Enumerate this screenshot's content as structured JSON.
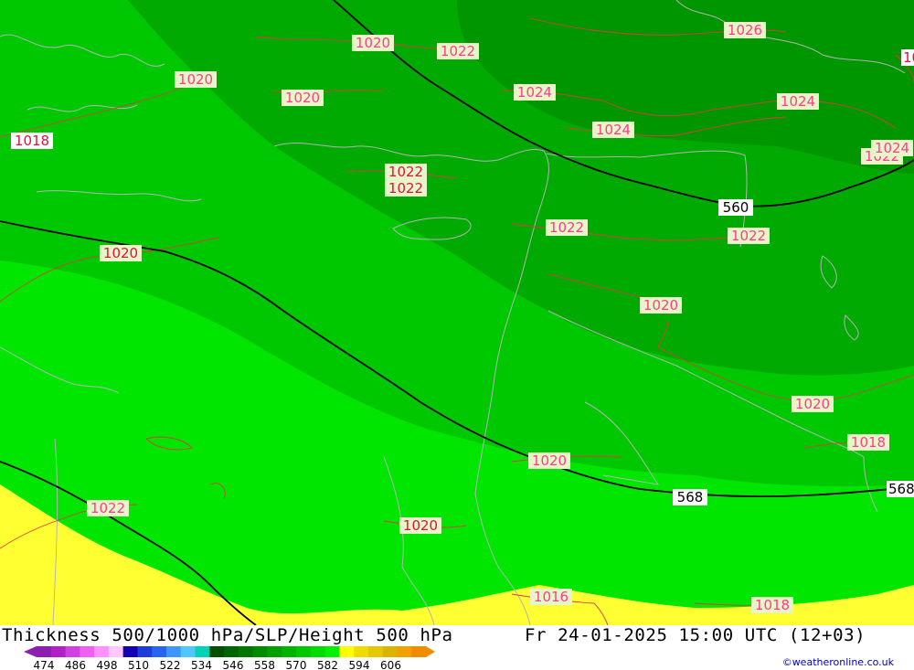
{
  "footer": {
    "title": "Thickness 500/1000 hPa/SLP/Height 500 hPa",
    "datetime": "Fr 24-01-2025 15:00 UTC (12+03)",
    "credit": "©weatheronline.co.uk"
  },
  "colorscale": {
    "ticks": [
      "474",
      "486",
      "498",
      "510",
      "522",
      "534",
      "546",
      "558",
      "570",
      "582",
      "594",
      "606"
    ],
    "colors": [
      "#8c1fb0",
      "#b020c8",
      "#d040e0",
      "#f060f0",
      "#ff90ff",
      "#ffc8ff",
      "#1400b4",
      "#1e3cdc",
      "#2864f0",
      "#3c96ff",
      "#50c8ff",
      "#00d2b4",
      "#005000",
      "#006400",
      "#007800",
      "#008c00",
      "#00a000",
      "#00b400",
      "#00c800",
      "#00dc00",
      "#00f000",
      "#ffff00",
      "#f0dc00",
      "#e6c800",
      "#dcb400",
      "#f0a000",
      "#f08c00"
    ]
  },
  "map": {
    "pressure_labels": [
      {
        "text": "1020",
        "style": "pink"
      },
      {
        "text": "1022",
        "style": "pink"
      },
      {
        "text": "1026",
        "style": "pink"
      },
      {
        "text": "1020",
        "style": "pink"
      },
      {
        "text": "1020",
        "style": "pink"
      },
      {
        "text": "1024",
        "style": "pink"
      },
      {
        "text": "1024",
        "style": "pink"
      },
      {
        "text": "1024",
        "style": "pink"
      },
      {
        "text": "1018",
        "style": "red"
      },
      {
        "text": "1022",
        "style": "red"
      },
      {
        "text": "1022",
        "style": "red"
      },
      {
        "text": "1022",
        "style": "pink"
      },
      {
        "text": "1024",
        "style": "pink"
      },
      {
        "text": "1022",
        "style": "pink"
      },
      {
        "text": "1022",
        "style": "pink"
      },
      {
        "text": "1020",
        "style": "red"
      },
      {
        "text": "1020",
        "style": "pink"
      },
      {
        "text": "1020",
        "style": "pink"
      },
      {
        "text": "1018",
        "style": "pink"
      },
      {
        "text": "1020",
        "style": "pink"
      },
      {
        "text": "1022",
        "style": "pink"
      },
      {
        "text": "1020",
        "style": "red"
      },
      {
        "text": "1016",
        "style": "pink"
      },
      {
        "text": "1018",
        "style": "pink"
      },
      {
        "text": "10",
        "style": "red"
      }
    ],
    "height_labels": [
      "560",
      "568",
      "568"
    ]
  }
}
